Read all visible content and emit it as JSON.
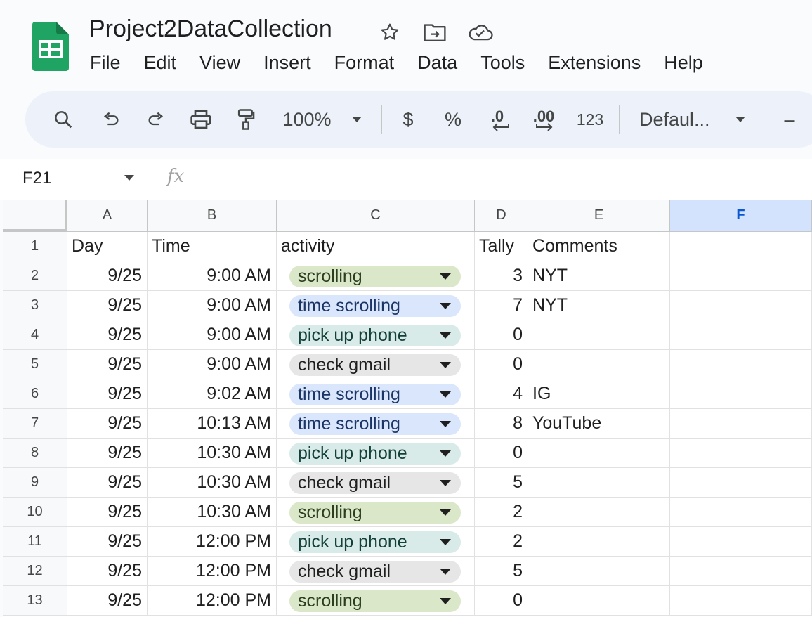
{
  "doc": {
    "title": "Project2DataCollection",
    "icons": [
      "star-icon",
      "move-folder-icon",
      "cloud-saved-icon"
    ]
  },
  "menu": [
    "File",
    "Edit",
    "View",
    "Insert",
    "Format",
    "Data",
    "Tools",
    "Extensions",
    "Help"
  ],
  "toolbar": {
    "zoom": "100%",
    "currency": "$",
    "percent": "%",
    "decrease_decimal": ".0",
    "increase_decimal": ".00",
    "more_formats": "123",
    "font": "Defaul...",
    "font_size_minus": "–"
  },
  "formula_bar": {
    "cell_ref": "F21",
    "fx": "fx",
    "value": ""
  },
  "columns": [
    "A",
    "B",
    "C",
    "D",
    "E",
    "F"
  ],
  "selected_column": "F",
  "rows": [
    {
      "n": "1",
      "day": "Day",
      "time": "Time",
      "activity": "activity",
      "tally": "Tally",
      "comments": "Comments"
    },
    {
      "n": "2",
      "day": "9/25",
      "time": "9:00 AM",
      "activity": "scrolling",
      "tally": "3",
      "comments": "NYT"
    },
    {
      "n": "3",
      "day": "9/25",
      "time": "9:00 AM",
      "activity": "time scrolling",
      "tally": "7",
      "comments": "NYT"
    },
    {
      "n": "4",
      "day": "9/25",
      "time": "9:00 AM",
      "activity": "pick up phone",
      "tally": "0",
      "comments": ""
    },
    {
      "n": "5",
      "day": "9/25",
      "time": "9:00 AM",
      "activity": "check gmail",
      "tally": "0",
      "comments": ""
    },
    {
      "n": "6",
      "day": "9/25",
      "time": "9:02 AM",
      "activity": "time scrolling",
      "tally": "4",
      "comments": "IG"
    },
    {
      "n": "7",
      "day": "9/25",
      "time": "10:13 AM",
      "activity": "time scrolling",
      "tally": "8",
      "comments": "YouTube"
    },
    {
      "n": "8",
      "day": "9/25",
      "time": "10:30 AM",
      "activity": "pick up phone",
      "tally": "0",
      "comments": ""
    },
    {
      "n": "9",
      "day": "9/25",
      "time": "10:30 AM",
      "activity": "check gmail",
      "tally": "5",
      "comments": ""
    },
    {
      "n": "10",
      "day": "9/25",
      "time": "10:30 AM",
      "activity": "scrolling",
      "tally": "2",
      "comments": ""
    },
    {
      "n": "11",
      "day": "9/25",
      "time": "12:00 PM",
      "activity": "pick up phone",
      "tally": "2",
      "comments": ""
    },
    {
      "n": "12",
      "day": "9/25",
      "time": "12:00 PM",
      "activity": "check gmail",
      "tally": "5",
      "comments": ""
    },
    {
      "n": "13",
      "day": "9/25",
      "time": "12:00 PM",
      "activity": "scrolling",
      "tally": "0",
      "comments": ""
    }
  ],
  "chip_colors": {
    "scrolling": {
      "bg": "#dbe7c9",
      "fg": "#2b3f1e"
    },
    "time scrolling": {
      "bg": "#d9e6fb",
      "fg": "#1a3566"
    },
    "pick up phone": {
      "bg": "#d8ebe8",
      "fg": "#14403a"
    },
    "check gmail": {
      "bg": "#e6e6e6",
      "fg": "#1f1f1f"
    }
  }
}
